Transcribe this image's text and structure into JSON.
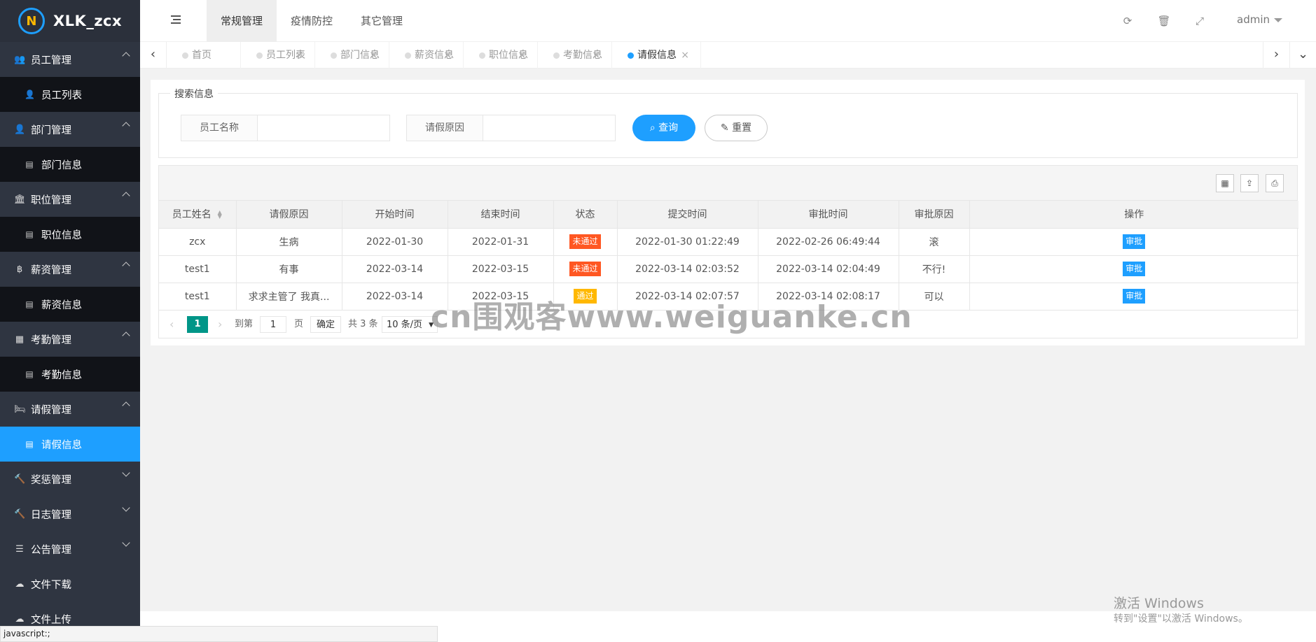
{
  "app": {
    "logo_text": "XLK_zcx"
  },
  "sidebar": {
    "items": [
      {
        "label": "员工管理",
        "icon": "users-icon",
        "type": "group",
        "expanded": true
      },
      {
        "label": "员工列表",
        "icon": "user-icon",
        "type": "sub"
      },
      {
        "label": "部门管理",
        "icon": "user-icon",
        "type": "group",
        "expanded": true
      },
      {
        "label": "部门信息",
        "icon": "table-icon",
        "type": "sub"
      },
      {
        "label": "职位管理",
        "icon": "bank-icon",
        "type": "group",
        "expanded": true
      },
      {
        "label": "职位信息",
        "icon": "table-icon",
        "type": "sub"
      },
      {
        "label": "薪资管理",
        "icon": "bitcoin-icon",
        "type": "group",
        "expanded": true
      },
      {
        "label": "薪资信息",
        "icon": "table-icon",
        "type": "sub"
      },
      {
        "label": "考勤管理",
        "icon": "calendar-icon",
        "type": "group",
        "expanded": true
      },
      {
        "label": "考勤信息",
        "icon": "table-icon",
        "type": "sub"
      },
      {
        "label": "请假管理",
        "icon": "bed-icon",
        "type": "group",
        "expanded": true
      },
      {
        "label": "请假信息",
        "icon": "table-icon",
        "type": "sub",
        "active": true
      },
      {
        "label": "奖惩管理",
        "icon": "gavel-icon",
        "type": "group",
        "expanded": false
      },
      {
        "label": "日志管理",
        "icon": "gavel-icon",
        "type": "group",
        "expanded": false
      },
      {
        "label": "公告管理",
        "icon": "list-icon",
        "type": "group",
        "expanded": false
      },
      {
        "label": "文件下载",
        "icon": "cloud-download-icon",
        "type": "group"
      },
      {
        "label": "文件上传",
        "icon": "cloud-upload-icon",
        "type": "group"
      }
    ]
  },
  "header": {
    "menus": [
      "常规管理",
      "疫情防控",
      "其它管理"
    ],
    "active_menu": "常规管理",
    "user": "admin"
  },
  "tabs": [
    {
      "label": "首页",
      "closable": false
    },
    {
      "label": "员工列表",
      "closable": true
    },
    {
      "label": "部门信息",
      "closable": true
    },
    {
      "label": "薪资信息",
      "closable": true
    },
    {
      "label": "职位信息",
      "closable": true
    },
    {
      "label": "考勤信息",
      "closable": true
    },
    {
      "label": "请假信息",
      "closable": true,
      "active": true
    }
  ],
  "search": {
    "legend": "搜索信息",
    "name_label": "员工名称",
    "reason_label": "请假原因",
    "query_button": "查询",
    "reset_button": "重置"
  },
  "table": {
    "columns": [
      "员工姓名",
      "请假原因",
      "开始时间",
      "结束时间",
      "状态",
      "提交时间",
      "审批时间",
      "审批原因",
      "操作"
    ],
    "rows": [
      {
        "name": "zcx",
        "reason": "生病",
        "start": "2022-01-30",
        "end": "2022-01-31",
        "status": "未通过",
        "status_color": "#ff5722",
        "submit": "2022-01-30 01:22:49",
        "approve": "2022-02-26 06:49:44",
        "approve_reason": "滚",
        "action": "审批"
      },
      {
        "name": "test1",
        "reason": "有事",
        "start": "2022-03-14",
        "end": "2022-03-15",
        "status": "未通过",
        "status_color": "#ff5722",
        "submit": "2022-03-14 02:03:52",
        "approve": "2022-03-14 02:04:49",
        "approve_reason": "不行!",
        "action": "审批"
      },
      {
        "name": "test1",
        "reason": "求求主管了 我真...",
        "start": "2022-03-14",
        "end": "2022-03-15",
        "status": "通过",
        "status_color": "#ffb800",
        "submit": "2022-03-14 02:07:57",
        "approve": "2022-03-14 02:08:17",
        "approve_reason": "可以",
        "action": "审批"
      }
    ]
  },
  "pager": {
    "current": "1",
    "goto_prefix": "到第",
    "goto_value": "1",
    "goto_suffix": "页",
    "confirm": "确定",
    "total": "共 3 条",
    "page_size": "10 条/页"
  },
  "statusbar": {
    "text": "javascript:;"
  },
  "watermark": {
    "text": "cn围观客www.weiguanke.cn"
  },
  "windows": {
    "line1": "激活 Windows",
    "line2": "转到\"设置\"以激活 Windows。"
  },
  "colors": {
    "accent": "#1e9fff",
    "sidebar_bg": "#2f3541",
    "submenu_bg": "#111318",
    "danger": "#ff5722",
    "warn": "#ffb800",
    "pager_active": "#009688"
  }
}
